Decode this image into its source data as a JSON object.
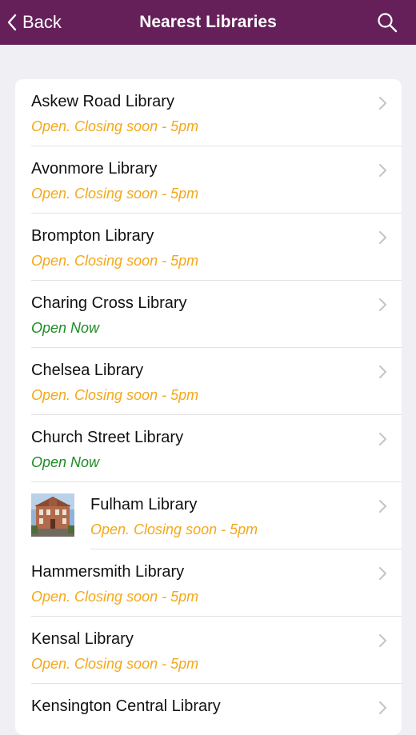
{
  "nav": {
    "back_label": "Back",
    "title": "Nearest Libraries",
    "search_icon": "search-icon",
    "back_icon": "chevron-left-icon"
  },
  "colors": {
    "nav_background": "#652059",
    "closing_soon": "#f3a81b",
    "open_now": "#1e8c26",
    "page_background": "#efeff4"
  },
  "libraries": [
    {
      "name": "Askew Road Library",
      "status": "Open. Closing soon - 5pm",
      "state": "closing"
    },
    {
      "name": "Avonmore Library",
      "status": "Open. Closing soon - 5pm",
      "state": "closing"
    },
    {
      "name": "Brompton Library",
      "status": "Open. Closing soon - 5pm",
      "state": "closing"
    },
    {
      "name": "Charing Cross Library",
      "status": "Open Now",
      "state": "open"
    },
    {
      "name": "Chelsea Library",
      "status": "Open. Closing soon - 5pm",
      "state": "closing"
    },
    {
      "name": "Church Street Library",
      "status": "Open Now",
      "state": "open"
    },
    {
      "name": "Fulham Library",
      "status": "Open. Closing soon - 5pm",
      "state": "closing",
      "thumbnail": "library-building-photo"
    },
    {
      "name": "Hammersmith Library",
      "status": "Open. Closing soon - 5pm",
      "state": "closing"
    },
    {
      "name": "Kensal Library",
      "status": "Open. Closing soon - 5pm",
      "state": "closing"
    },
    {
      "name": "Kensington Central Library",
      "status": "",
      "state": "closing"
    }
  ]
}
